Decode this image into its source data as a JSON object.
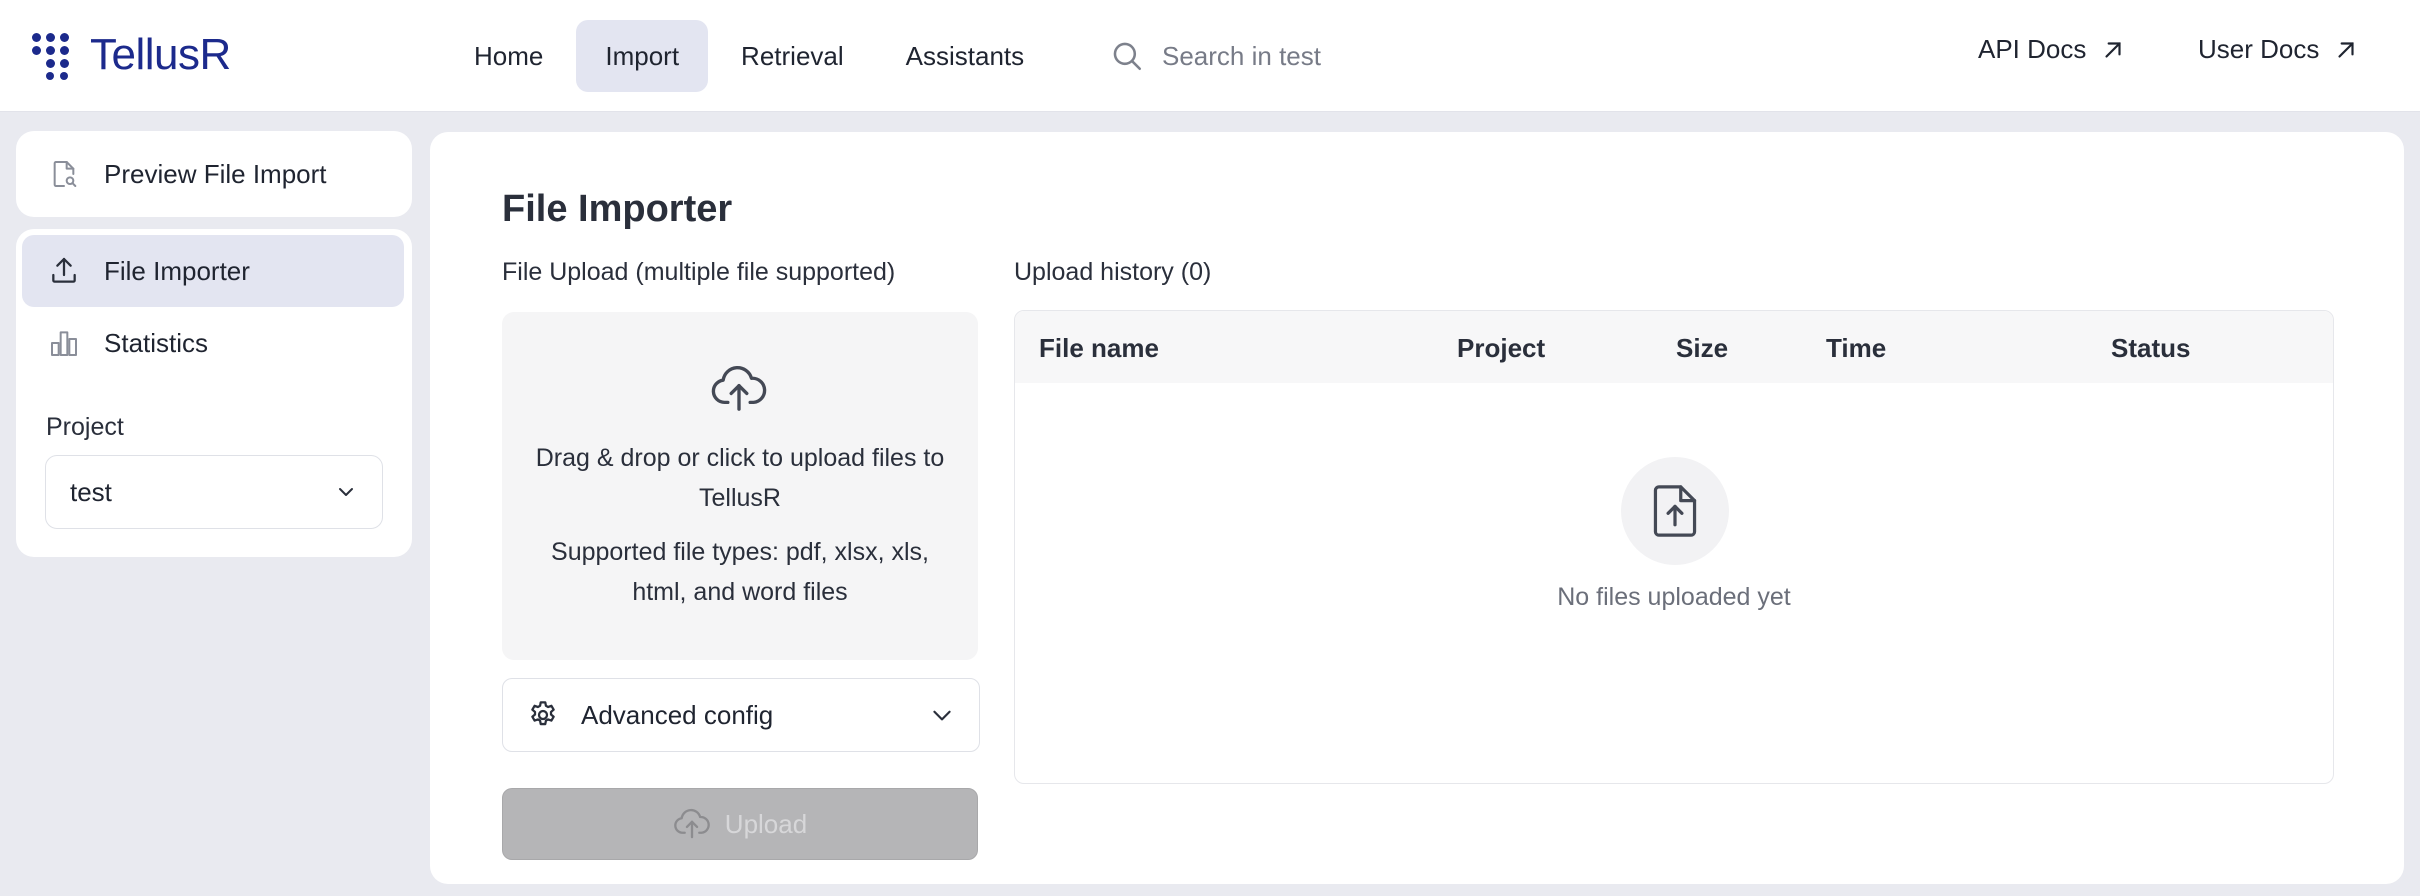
{
  "header": {
    "logo_text": "TellusR",
    "nav": [
      {
        "label": "Home",
        "active": false
      },
      {
        "label": "Import",
        "active": true
      },
      {
        "label": "Retrieval",
        "active": false
      },
      {
        "label": "Assistants",
        "active": false
      }
    ],
    "search": {
      "placeholder": "Search in test",
      "value": ""
    },
    "api_docs_label": "API Docs",
    "user_docs_label": "User Docs"
  },
  "sidebar": {
    "preview_label": "Preview File Import",
    "items": [
      {
        "label": "File Importer",
        "active": true,
        "icon": "upload-icon"
      },
      {
        "label": "Statistics",
        "active": false,
        "icon": "bar-chart-icon"
      }
    ],
    "project_label": "Project",
    "project_value": "test"
  },
  "main": {
    "title": "File Importer",
    "upload_label": "File Upload (multiple file supported)",
    "dropzone_text": "Drag & drop or click to upload files to TellusR",
    "supported_types_text": "Supported file types: pdf, xlsx, xls, html, and word files",
    "advanced_config_label": "Advanced config",
    "upload_button_label": "Upload",
    "history_label": "Upload history (0)",
    "table_headers": [
      "File name",
      "Project",
      "Size",
      "Time",
      "Status"
    ],
    "empty_text": "No files uploaded yet"
  },
  "colors": {
    "brand": "#1c2a8c",
    "active_bg": "#e3e5f1",
    "page_bg": "#e9eaf0",
    "disabled_button": "#b5b5b7"
  }
}
